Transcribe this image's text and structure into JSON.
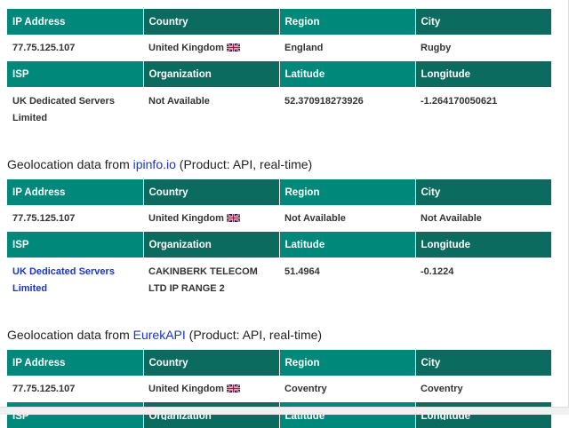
{
  "headers_row1": [
    "IP Address",
    "Country",
    "Region",
    "City"
  ],
  "headers_row2": [
    "ISP",
    "Organization",
    "Latitude",
    "Longitude"
  ],
  "section1": {
    "ip": "77.75.125.107",
    "country": "United Kingdom",
    "region": "England",
    "city": "Rugby",
    "isp": "UK Dedicated Servers Limited",
    "organization": "Not Available",
    "latitude": "52.370918273926",
    "longitude": "-1.264170050621"
  },
  "section2": {
    "caption_prefix": "Geolocation data from ",
    "caption_link": "ipinfo.io",
    "caption_suffix": " (Product: API, real-time)",
    "ip": "77.75.125.107",
    "country": "United Kingdom",
    "region": "Not Available",
    "city": "Not Available",
    "isp": "UK Dedicated Servers Limited",
    "organization": "CAKINBERK TELECOM LTD IP RANGE 2",
    "latitude": "51.4964",
    "longitude": "-0.1224"
  },
  "section3": {
    "caption_prefix": "Geolocation data from ",
    "caption_link": "EurekAPI",
    "caption_suffix": " (Product: API, real-time)",
    "ip": "77.75.125.107",
    "country": "United Kingdom",
    "region": "Coventry",
    "city": "Coventry"
  },
  "flag_icon": "uk-flag-icon",
  "colors": {
    "header": "#00897b",
    "header_dark": "#0a6b5e",
    "link": "#1a36c4"
  }
}
